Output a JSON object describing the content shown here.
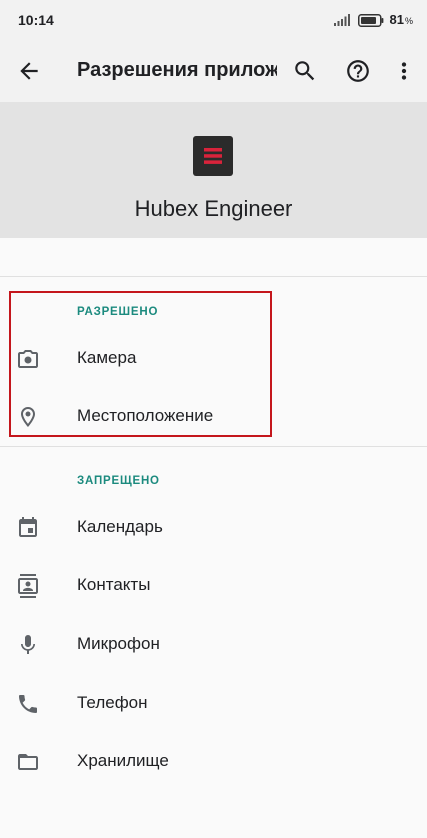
{
  "status_bar": {
    "time": "10:14",
    "battery_percent": "81",
    "battery_unit": "%"
  },
  "app_bar": {
    "title": "Разрешения приложений",
    "back_icon": "arrow-back-icon",
    "search_icon": "search-icon",
    "help_icon": "help-circle-icon",
    "more_icon": "more-vert-icon"
  },
  "app_header": {
    "app_name": "Hubex Engineer"
  },
  "sections": {
    "allowed": {
      "title": "РАЗРЕШЕНО",
      "items": [
        {
          "label": "Камера",
          "icon": "camera-icon"
        },
        {
          "label": "Местоположение",
          "icon": "location-pin-icon"
        }
      ]
    },
    "denied": {
      "title": "ЗАПРЕЩЕНО",
      "items": [
        {
          "label": "Календарь",
          "icon": "calendar-icon"
        },
        {
          "label": "Контакты",
          "icon": "contacts-icon"
        },
        {
          "label": "Микрофон",
          "icon": "microphone-icon"
        },
        {
          "label": "Телефон",
          "icon": "phone-icon"
        },
        {
          "label": "Хранилище",
          "icon": "folder-icon"
        }
      ]
    }
  },
  "colors": {
    "accent": "#1b8a7e",
    "highlight": "#c4161c",
    "icon": "#5f6368"
  }
}
